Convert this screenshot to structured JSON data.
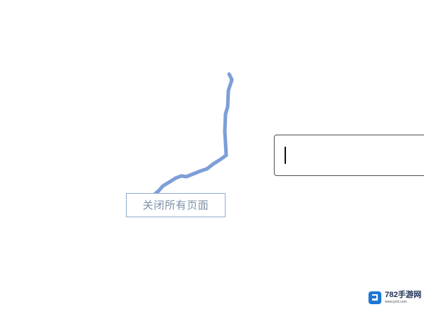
{
  "tooltip": {
    "label": "关闭所有页面"
  },
  "input": {
    "value": ""
  },
  "watermark": {
    "brand": "782手游网",
    "domain": "www.pc6.com"
  },
  "colors": {
    "trail": "#7d9ed8",
    "tooltip_border": "#8faed0",
    "tooltip_text": "#7f90a8",
    "watermark_blue": "#1e78d4"
  },
  "icons": {
    "watermark": "brand-logo-icon"
  }
}
